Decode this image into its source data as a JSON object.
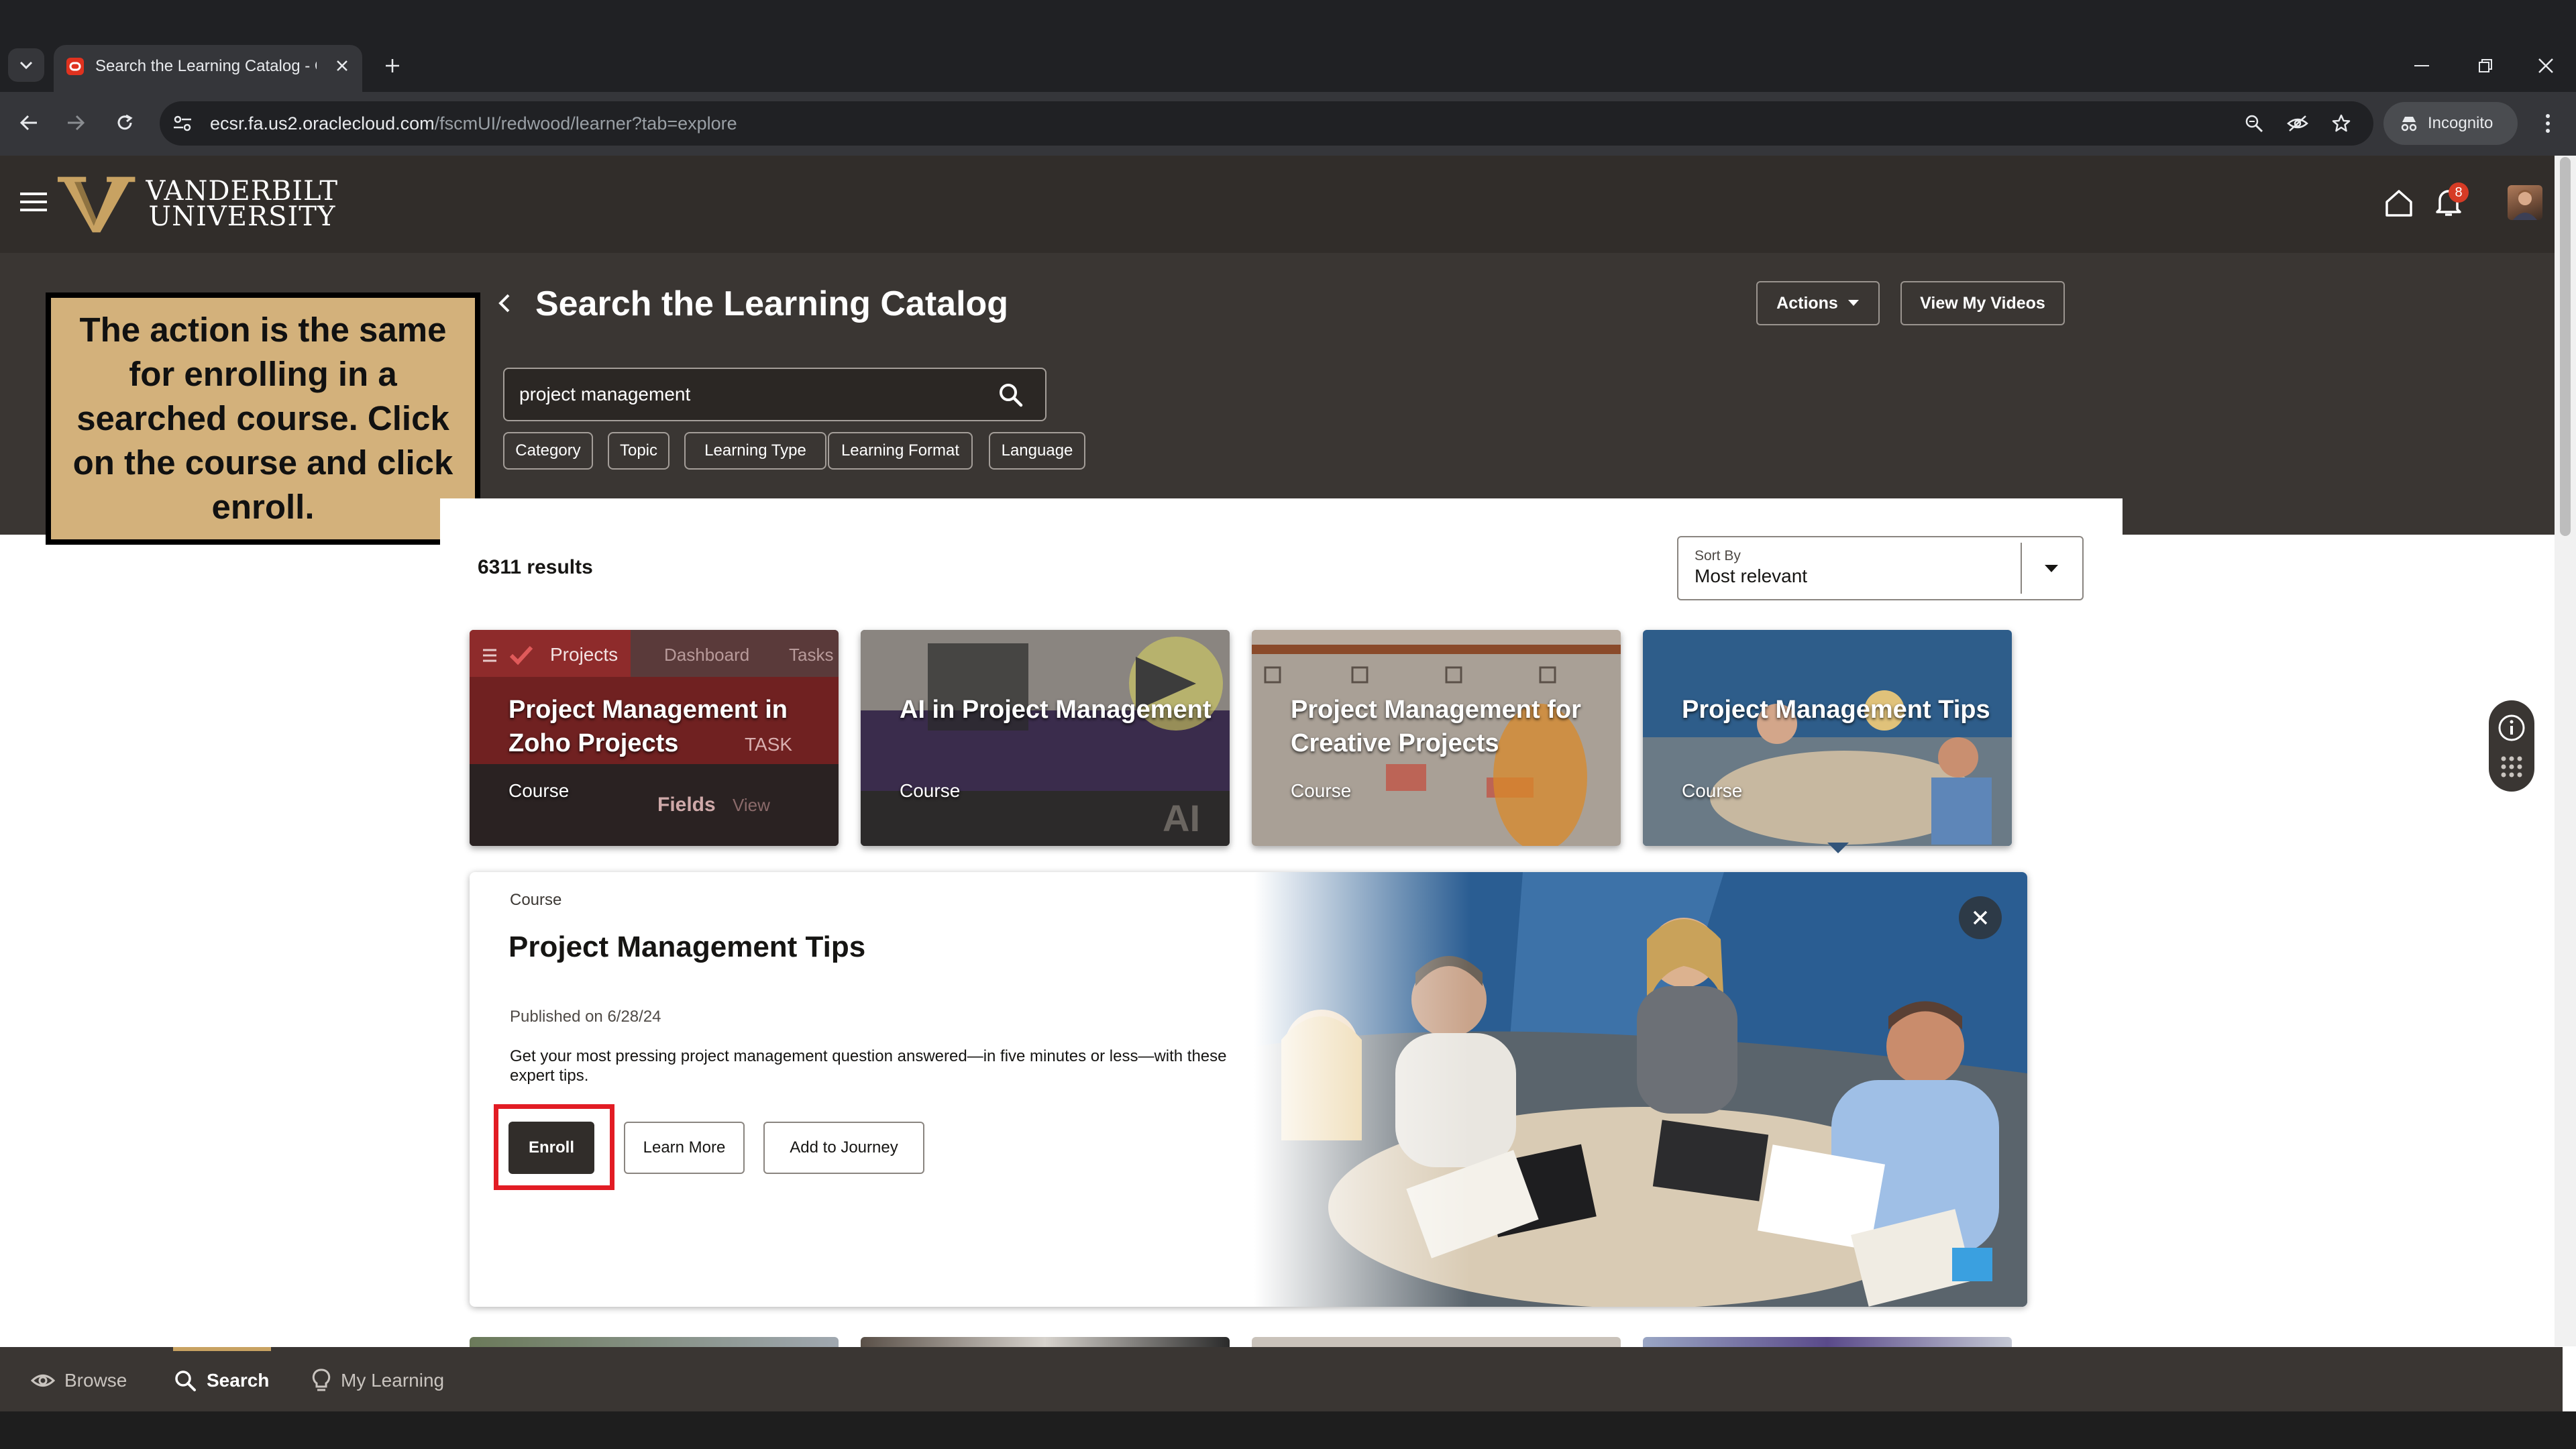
{
  "browser": {
    "tab_title": "Search the Learning Catalog - C",
    "url_host": "ecsr.fa.us2.oraclecloud.com",
    "url_path": "/fscmUI/redwood/learner?tab=explore",
    "incognito_label": "Incognito"
  },
  "header": {
    "logo_line1": "VANDERBILT",
    "logo_line2": "UNIVERSITY",
    "notification_count": "8"
  },
  "page": {
    "title": "Search the Learning Catalog",
    "actions_label": "Actions",
    "view_videos_label": "View My Videos"
  },
  "search": {
    "value": "project management",
    "filters": [
      "Category",
      "Topic",
      "Learning Type",
      "Learning Format",
      "Language"
    ]
  },
  "callout": {
    "text": "The action is the same for enrolling in a searched course. Click on the course and click enroll."
  },
  "results": {
    "count": "6311 results",
    "sort_label": "Sort By",
    "sort_value": "Most relevant",
    "cards": [
      {
        "title": "Project Management in Zoho Projects",
        "type": "Course"
      },
      {
        "title": "AI in Project Management",
        "type": "Course"
      },
      {
        "title": "Project Management for Creative Projects",
        "type": "Course"
      },
      {
        "title": "Project Management Tips",
        "type": "Course"
      }
    ]
  },
  "detail": {
    "type": "Course",
    "title": "Project Management Tips",
    "published": "Published on 6/28/24",
    "description": "Get your most pressing project management question answered—in five minutes or less—with these expert tips.",
    "enroll_label": "Enroll",
    "learn_more_label": "Learn More",
    "add_journey_label": "Add to Journey"
  },
  "bottom_nav": {
    "browse": "Browse",
    "search": "Search",
    "my_learning": "My Learning"
  },
  "colors": {
    "brand_gold": "#c8a262",
    "header_dark": "#312d2a",
    "highlight_red": "#e21c24"
  }
}
